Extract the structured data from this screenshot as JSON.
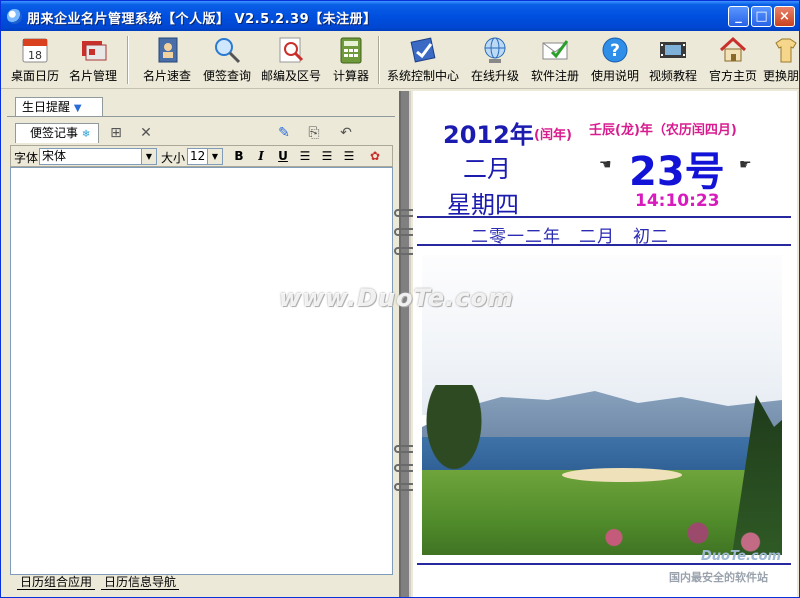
{
  "window": {
    "title": "朋来企业名片管理系统【个人版】 V2.5.2.39【未注册】",
    "min": "_",
    "max": "□",
    "close": "×"
  },
  "toolbar": {
    "items": [
      {
        "id": "desktop-calendar",
        "label": "桌面日历",
        "icon": "calendar-icon"
      },
      {
        "id": "card-manage",
        "label": "名片管理",
        "icon": "business-card-icon"
      },
      {
        "id": "card-quick",
        "label": "名片速查",
        "icon": "address-book-icon"
      },
      {
        "id": "note-query",
        "label": "便签查询",
        "icon": "magnifier-icon"
      },
      {
        "id": "postcode",
        "label": "邮编及区号",
        "icon": "search-doc-icon"
      },
      {
        "id": "calculator",
        "label": "计算器",
        "icon": "calculator-icon"
      },
      {
        "id": "control-center",
        "label": "系统控制中心",
        "icon": "control-center-icon"
      },
      {
        "id": "upgrade",
        "label": "在线升级",
        "icon": "globe-icon"
      },
      {
        "id": "register",
        "label": "软件注册",
        "icon": "envelope-check-icon"
      },
      {
        "id": "help",
        "label": "使用说明",
        "icon": "help-icon"
      },
      {
        "id": "video",
        "label": "视频教程",
        "icon": "film-icon"
      },
      {
        "id": "homepage",
        "label": "官方主页",
        "icon": "house-icon"
      },
      {
        "id": "skin",
        "label": "更换朋",
        "icon": "tshirt-icon"
      }
    ]
  },
  "left": {
    "birthday_tab": "生日提醒",
    "note_tab": "便签记事",
    "font_label": "字体",
    "font_value": "宋体",
    "size_label": "大小",
    "size_value": "12",
    "bold": "B",
    "italic": "I",
    "underline": "U",
    "bottom_tabs": [
      "日历组合应用",
      "日历信息导航"
    ]
  },
  "calendar": {
    "year": "2012年",
    "leap": "(闰年)",
    "lunar_year": "壬辰(龙)年（农历闰四月)",
    "month": "二月",
    "day": "23号",
    "weekday": "星期四",
    "time": "14:10:23",
    "chinese_date": "二零一二年　二月　初二"
  },
  "watermarks": {
    "main": "www.DuoTe.com",
    "corner": "国内最安全的软件站",
    "corner_logo": "DuoTe.com"
  }
}
